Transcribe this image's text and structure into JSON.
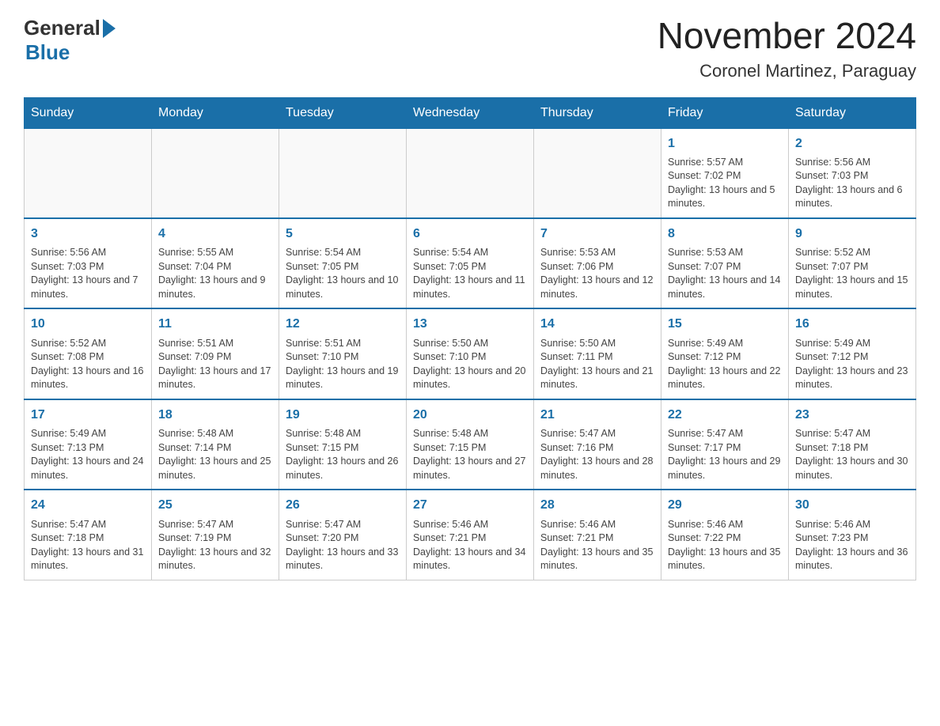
{
  "logo": {
    "text_general": "General",
    "text_blue": "Blue"
  },
  "header": {
    "title": "November 2024",
    "subtitle": "Coronel Martinez, Paraguay"
  },
  "weekdays": [
    "Sunday",
    "Monday",
    "Tuesday",
    "Wednesday",
    "Thursday",
    "Friday",
    "Saturday"
  ],
  "weeks": [
    [
      {
        "day": "",
        "info": ""
      },
      {
        "day": "",
        "info": ""
      },
      {
        "day": "",
        "info": ""
      },
      {
        "day": "",
        "info": ""
      },
      {
        "day": "",
        "info": ""
      },
      {
        "day": "1",
        "info": "Sunrise: 5:57 AM\nSunset: 7:02 PM\nDaylight: 13 hours and 5 minutes."
      },
      {
        "day": "2",
        "info": "Sunrise: 5:56 AM\nSunset: 7:03 PM\nDaylight: 13 hours and 6 minutes."
      }
    ],
    [
      {
        "day": "3",
        "info": "Sunrise: 5:56 AM\nSunset: 7:03 PM\nDaylight: 13 hours and 7 minutes."
      },
      {
        "day": "4",
        "info": "Sunrise: 5:55 AM\nSunset: 7:04 PM\nDaylight: 13 hours and 9 minutes."
      },
      {
        "day": "5",
        "info": "Sunrise: 5:54 AM\nSunset: 7:05 PM\nDaylight: 13 hours and 10 minutes."
      },
      {
        "day": "6",
        "info": "Sunrise: 5:54 AM\nSunset: 7:05 PM\nDaylight: 13 hours and 11 minutes."
      },
      {
        "day": "7",
        "info": "Sunrise: 5:53 AM\nSunset: 7:06 PM\nDaylight: 13 hours and 12 minutes."
      },
      {
        "day": "8",
        "info": "Sunrise: 5:53 AM\nSunset: 7:07 PM\nDaylight: 13 hours and 14 minutes."
      },
      {
        "day": "9",
        "info": "Sunrise: 5:52 AM\nSunset: 7:07 PM\nDaylight: 13 hours and 15 minutes."
      }
    ],
    [
      {
        "day": "10",
        "info": "Sunrise: 5:52 AM\nSunset: 7:08 PM\nDaylight: 13 hours and 16 minutes."
      },
      {
        "day": "11",
        "info": "Sunrise: 5:51 AM\nSunset: 7:09 PM\nDaylight: 13 hours and 17 minutes."
      },
      {
        "day": "12",
        "info": "Sunrise: 5:51 AM\nSunset: 7:10 PM\nDaylight: 13 hours and 19 minutes."
      },
      {
        "day": "13",
        "info": "Sunrise: 5:50 AM\nSunset: 7:10 PM\nDaylight: 13 hours and 20 minutes."
      },
      {
        "day": "14",
        "info": "Sunrise: 5:50 AM\nSunset: 7:11 PM\nDaylight: 13 hours and 21 minutes."
      },
      {
        "day": "15",
        "info": "Sunrise: 5:49 AM\nSunset: 7:12 PM\nDaylight: 13 hours and 22 minutes."
      },
      {
        "day": "16",
        "info": "Sunrise: 5:49 AM\nSunset: 7:12 PM\nDaylight: 13 hours and 23 minutes."
      }
    ],
    [
      {
        "day": "17",
        "info": "Sunrise: 5:49 AM\nSunset: 7:13 PM\nDaylight: 13 hours and 24 minutes."
      },
      {
        "day": "18",
        "info": "Sunrise: 5:48 AM\nSunset: 7:14 PM\nDaylight: 13 hours and 25 minutes."
      },
      {
        "day": "19",
        "info": "Sunrise: 5:48 AM\nSunset: 7:15 PM\nDaylight: 13 hours and 26 minutes."
      },
      {
        "day": "20",
        "info": "Sunrise: 5:48 AM\nSunset: 7:15 PM\nDaylight: 13 hours and 27 minutes."
      },
      {
        "day": "21",
        "info": "Sunrise: 5:47 AM\nSunset: 7:16 PM\nDaylight: 13 hours and 28 minutes."
      },
      {
        "day": "22",
        "info": "Sunrise: 5:47 AM\nSunset: 7:17 PM\nDaylight: 13 hours and 29 minutes."
      },
      {
        "day": "23",
        "info": "Sunrise: 5:47 AM\nSunset: 7:18 PM\nDaylight: 13 hours and 30 minutes."
      }
    ],
    [
      {
        "day": "24",
        "info": "Sunrise: 5:47 AM\nSunset: 7:18 PM\nDaylight: 13 hours and 31 minutes."
      },
      {
        "day": "25",
        "info": "Sunrise: 5:47 AM\nSunset: 7:19 PM\nDaylight: 13 hours and 32 minutes."
      },
      {
        "day": "26",
        "info": "Sunrise: 5:47 AM\nSunset: 7:20 PM\nDaylight: 13 hours and 33 minutes."
      },
      {
        "day": "27",
        "info": "Sunrise: 5:46 AM\nSunset: 7:21 PM\nDaylight: 13 hours and 34 minutes."
      },
      {
        "day": "28",
        "info": "Sunrise: 5:46 AM\nSunset: 7:21 PM\nDaylight: 13 hours and 35 minutes."
      },
      {
        "day": "29",
        "info": "Sunrise: 5:46 AM\nSunset: 7:22 PM\nDaylight: 13 hours and 35 minutes."
      },
      {
        "day": "30",
        "info": "Sunrise: 5:46 AM\nSunset: 7:23 PM\nDaylight: 13 hours and 36 minutes."
      }
    ]
  ]
}
